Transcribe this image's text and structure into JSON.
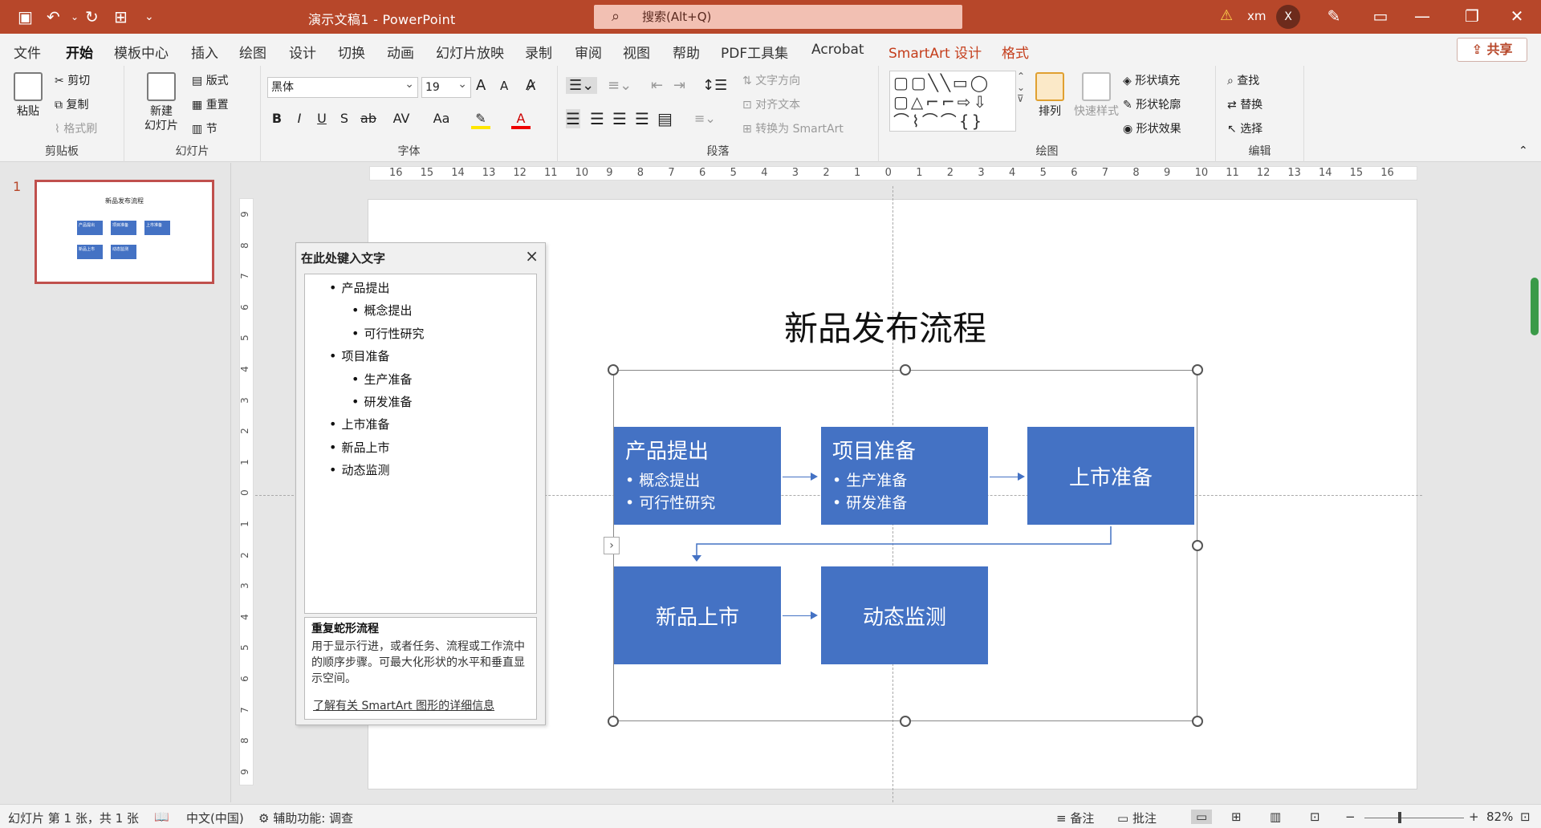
{
  "titlebar": {
    "title": "演示文稿1 - PowerPoint",
    "search_placeholder": "搜索(Alt+Q)",
    "user": "xm",
    "avatar": "X",
    "warn_icon": "warning-icon"
  },
  "menu": {
    "tabs": [
      "文件",
      "开始",
      "模板中心",
      "插入",
      "绘图",
      "设计",
      "切换",
      "动画",
      "幻灯片放映",
      "录制",
      "审阅",
      "视图",
      "帮助",
      "PDF工具集",
      "Acrobat",
      "SmartArt 设计",
      "格式"
    ],
    "active": "开始",
    "share": "共享"
  },
  "ribbon": {
    "clipboard": {
      "label": "剪贴板",
      "paste": "粘贴",
      "cut": "剪切",
      "copy": "复制",
      "format_painter": "格式刷"
    },
    "slides": {
      "label": "幻灯片",
      "new_slide": "新建\n幻灯片",
      "layout": "版式",
      "reset": "重置",
      "section": "节"
    },
    "font": {
      "label": "字体",
      "font_name": "黑体",
      "font_size": "19",
      "bold": "B",
      "italic": "I",
      "underline": "U",
      "shadow": "S",
      "strike": "ab",
      "spacing": "AV",
      "case": "Aa",
      "grow": "A",
      "shrink": "A"
    },
    "paragraph": {
      "label": "段落",
      "text_direction": "文字方向",
      "align_text": "对齐文本",
      "convert_smartart": "转换为 SmartArt"
    },
    "drawing": {
      "label": "绘图",
      "arrange": "排列",
      "quick_styles": "快速样式",
      "shape_fill": "形状填充",
      "shape_outline": "形状轮廓",
      "shape_effects": "形状效果"
    },
    "editing": {
      "label": "编辑",
      "find": "查找",
      "replace": "替换",
      "select": "选择"
    }
  },
  "thumbnail": {
    "number": "1",
    "title": "新品发布流程",
    "boxes": [
      "产品提出",
      "项目准备",
      "上市准备",
      "新品上市",
      "动态监测"
    ]
  },
  "ruler": {
    "h": [
      "16",
      "15",
      "14",
      "13",
      "12",
      "11",
      "10",
      "9",
      "8",
      "7",
      "6",
      "5",
      "4",
      "3",
      "2",
      "1",
      "0",
      "1",
      "2",
      "3",
      "4",
      "5",
      "6",
      "7",
      "8",
      "9",
      "10",
      "11",
      "12",
      "13",
      "14",
      "15",
      "16"
    ],
    "v": [
      "9",
      "8",
      "7",
      "6",
      "5",
      "4",
      "3",
      "2",
      "1",
      "0",
      "1",
      "2",
      "3",
      "4",
      "5",
      "6",
      "7",
      "8",
      "9"
    ]
  },
  "slide": {
    "title": "新品发布流程",
    "boxes": [
      {
        "title": "产品提出",
        "bullets": [
          "• 概念提出",
          "• 可行性研究"
        ]
      },
      {
        "title": "项目准备",
        "bullets": [
          "• 生产准备",
          "• 研发准备"
        ]
      },
      {
        "title": "上市准备"
      },
      {
        "title": "新品上市"
      },
      {
        "title": "动态监测"
      }
    ]
  },
  "textpane": {
    "title": "在此处键入文字",
    "items": [
      {
        "text": "产品提出",
        "level": 1
      },
      {
        "text": "概念提出",
        "level": 2
      },
      {
        "text": "可行性研究",
        "level": 2
      },
      {
        "text": "项目准备",
        "level": 1
      },
      {
        "text": "生产准备",
        "level": 2
      },
      {
        "text": "研发准备",
        "level": 2
      },
      {
        "text": "上市准备",
        "level": 1
      },
      {
        "text": "新品上市",
        "level": 1
      },
      {
        "text": "动态监测",
        "level": 1
      }
    ],
    "desc_title": "重复蛇形流程",
    "desc": "用于显示行进，或者任务、流程或工作流中的顺序步骤。可最大化形状的水平和垂直显示空间。",
    "link": "了解有关 SmartArt 图形的详细信息"
  },
  "status": {
    "slide_info": "幻灯片 第 1 张，共 1 张",
    "language": "中文(中国)",
    "accessibility": "辅助功能: 调查",
    "notes": "备注",
    "comments": "批注",
    "zoom": "82%",
    "minus": "−",
    "plus": "+"
  },
  "colors": {
    "brand": "#b7472a",
    "smartart": "#4472c4"
  }
}
